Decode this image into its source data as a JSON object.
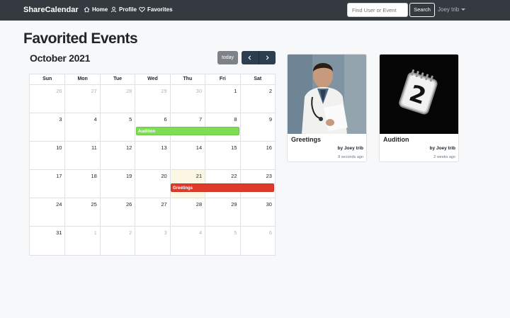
{
  "navbar": {
    "brand": "ShareCalendar",
    "links": [
      {
        "label": "Home",
        "icon": "home-icon"
      },
      {
        "label": "Profile",
        "icon": "user-icon"
      },
      {
        "label": "Favorites",
        "icon": "heart-icon"
      }
    ],
    "search_placeholder": "Find User or Event",
    "search_button": "Search",
    "user": "Joey trib"
  },
  "page_title": "Favorited Events",
  "calendar": {
    "title": "October 2021",
    "today_button": "today",
    "weekdays": [
      "Sun",
      "Mon",
      "Tue",
      "Wed",
      "Thu",
      "Fri",
      "Sat"
    ],
    "weeks": [
      [
        "26",
        "27",
        "28",
        "29",
        "30",
        "1",
        "2"
      ],
      [
        "3",
        "4",
        "5",
        "6",
        "7",
        "8",
        "9"
      ],
      [
        "10",
        "11",
        "12",
        "13",
        "14",
        "15",
        "16"
      ],
      [
        "17",
        "18",
        "19",
        "20",
        "21",
        "22",
        "23"
      ],
      [
        "24",
        "25",
        "26",
        "27",
        "28",
        "29",
        "30"
      ],
      [
        "31",
        "1",
        "2",
        "3",
        "4",
        "5",
        "6"
      ]
    ],
    "events": [
      {
        "title": "Audition",
        "color": "#7dde53"
      },
      {
        "title": "Greetings",
        "color": "#e03a2b"
      }
    ]
  },
  "cards": [
    {
      "title": "Greetings",
      "by": "by Joey trib",
      "time": "8 seconds ago"
    },
    {
      "title": "Audition",
      "by": "by Joey trib",
      "time": "2 weeks ago"
    }
  ],
  "colors": {
    "navbar": "#343a40",
    "accent_nav": "#2c3e50",
    "today_highlight": "#fcf8e3"
  }
}
